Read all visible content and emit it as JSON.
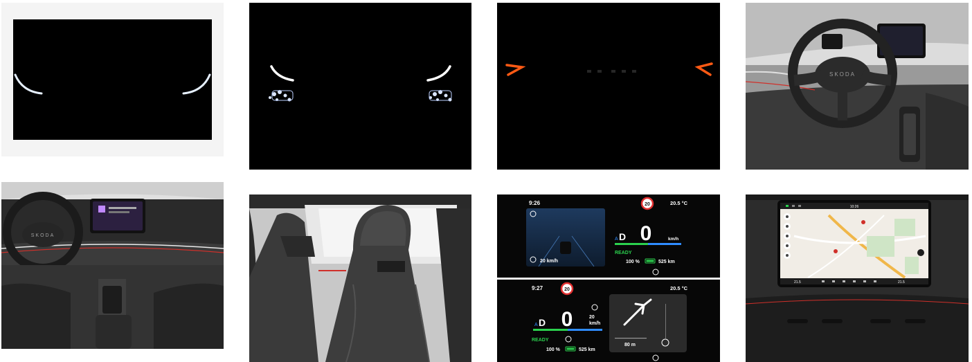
{
  "gallery": {
    "interior_steering_wheel": {
      "brand_logo": "SKODA"
    },
    "cluster_top": {
      "time": "9:26",
      "temperature": "20.5 °C",
      "speed_limit": "20",
      "gear": "D",
      "speed": "0",
      "speed_unit": "km/h",
      "acc_speed": "20 km/h",
      "status": "READY",
      "battery_pct": "100 %",
      "range": "525 km"
    },
    "cluster_bottom": {
      "time": "9:27",
      "temperature": "20.5 °C",
      "speed_limit": "20",
      "gear": "D",
      "speed": "0",
      "acc_speed": "20",
      "acc_unit": "km/h",
      "status": "READY",
      "battery_pct": "100 %",
      "range": "525 km",
      "nav_distance": "80 m"
    },
    "infotainment": {
      "clock": "10:26",
      "temp_left": "21.5",
      "temp_right": "21.5"
    }
  },
  "colors": {
    "headlight": "#e6f0ff",
    "taillight": "#ff5a14",
    "cluster_green": "#2bd14e",
    "cluster_blue": "#2f8cff",
    "ambient_red": "#d0302a"
  }
}
